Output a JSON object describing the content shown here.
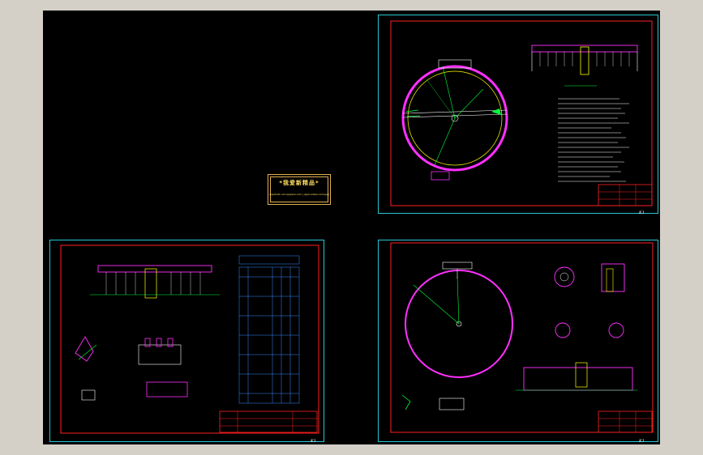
{
  "stamp": {
    "title": "*我爱新精品*",
    "subtitle": "qqsotudi.com.qqwera.com | qpen.sdsss.com/qqq"
  },
  "sheets": [
    {
      "id": "top-right",
      "label": "K1"
    },
    {
      "id": "bottom-left",
      "label": "K1"
    },
    {
      "id": "bottom-right",
      "label": "K1"
    }
  ],
  "colors": {
    "background": "#000000",
    "app_chrome": "#d4d0c8",
    "sheet_border": "#27c6d0",
    "frame": "#ff2020",
    "ring": "#ff30ff",
    "stamp": "#e0b050",
    "linework_green": "#00ff3a",
    "linework_yellow": "#ffff00"
  }
}
